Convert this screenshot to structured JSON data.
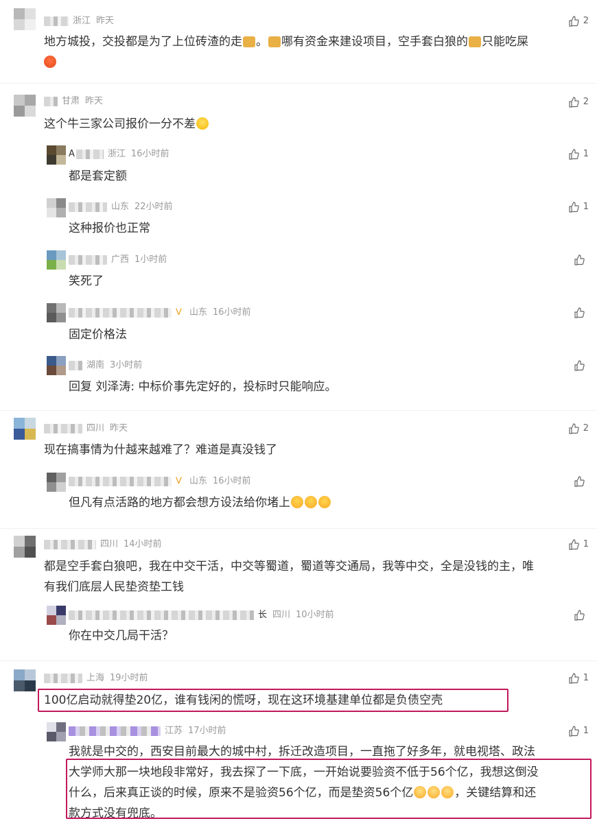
{
  "colors": {
    "text": "#333333",
    "meta": "#999999",
    "highlight": "#c2185b"
  },
  "comments": [
    {
      "id": "c1",
      "location": "浙江",
      "time": "昨天",
      "text": "地方城投，交投都是为了上位砖渣的走",
      "text2": "。",
      "text3": "哪有资金来建设项目，空手套白狼的",
      "text4": "只能吃屎",
      "likes": "2"
    },
    {
      "id": "c2",
      "location": "甘肃",
      "time": "昨天",
      "text": "这个牛三家公司报价一分不差",
      "likes": "2",
      "replies": [
        {
          "name": "A",
          "location": "浙江",
          "time": "16小时前",
          "text": "都是套定额",
          "likes": "1"
        },
        {
          "location": "山东",
          "time": "22小时前",
          "text": "这种报价也正常",
          "likes": "1"
        },
        {
          "location": "广西",
          "time": "1小时前",
          "text": "笑死了",
          "likes": ""
        },
        {
          "location": "山东",
          "time": "16小时前",
          "text": "固定价格法",
          "likes": ""
        },
        {
          "location": "湖南",
          "time": "3小时前",
          "text": "回复 刘泽涛: 中标价事先定好的，投标时只能响应。",
          "likes": ""
        }
      ]
    },
    {
      "id": "c3",
      "location": "四川",
      "time": "昨天",
      "text": "现在搞事情为什越来越难了？难道是真没钱了",
      "likes": "2",
      "replies": [
        {
          "location": "山东",
          "time": "16小时前",
          "text": "但凡有点活路的地方都会想方设法给你堵上",
          "likes": ""
        }
      ]
    },
    {
      "id": "c4",
      "location": "四川",
      "time": "14小时前",
      "text_line1": "都是空手套白狼吧，我在中交干活，中交等蜀道，蜀道等交通局，我等中交，全是没钱的主，唯",
      "text_line2": "有我们底层人民垫资垫工钱",
      "likes": "1",
      "replies": [
        {
          "name_suffix": "长",
          "location": "四川",
          "time": "10小时前",
          "text": "你在中交几局干活？",
          "likes": ""
        }
      ]
    },
    {
      "id": "c5",
      "location": "上海",
      "time": "19小时前",
      "text": "100亿启动就得垫20亿，谁有钱闲的慌呀，现在这环境基建单位都是负债空壳",
      "likes": "1",
      "replies": [
        {
          "location": "江苏",
          "time": "17小时前",
          "line1": "我就是中交的，西安目前最大的城中村，拆迁改造项目，一直拖了好多年，就电视塔、政法",
          "line2": "大学师大那一块地段非常好，我去探了一下底，一开始说要验资不低于56个亿，我想这倒没",
          "line3a": "什么，后来真正谈的时候，原来不是验资56个亿，而是垫资56个亿",
          "line3b": "，关键结算和还",
          "line4": "款方式没有兜底。",
          "likes": "1"
        }
      ]
    }
  ]
}
